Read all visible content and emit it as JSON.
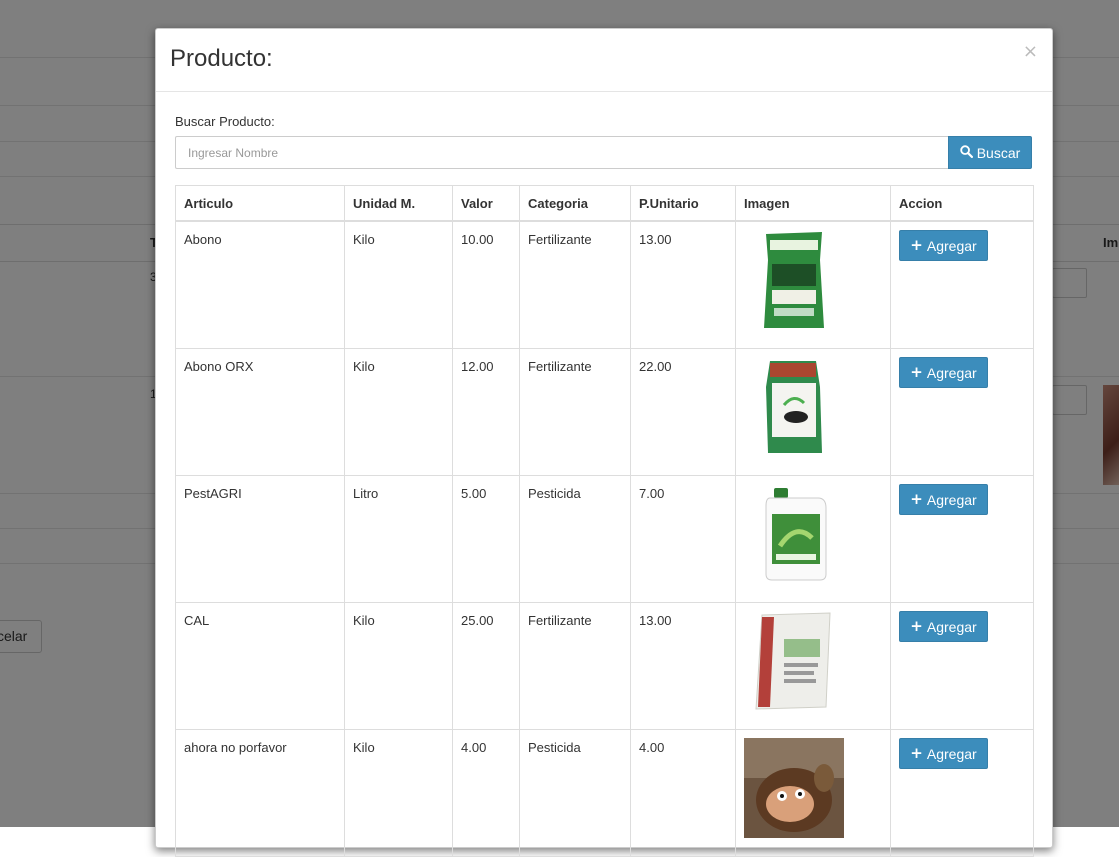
{
  "background": {
    "table_header_fragments": [
      "T",
      "Im"
    ],
    "row_numbers": [
      "3",
      "1"
    ],
    "cancel_fragment": "celar"
  },
  "modal": {
    "title": "Producto:",
    "close_symbol": "×"
  },
  "search": {
    "label": "Buscar Producto:",
    "placeholder": "Ingresar Nombre",
    "value": "",
    "button_label": "Buscar",
    "button_icon": "search-icon"
  },
  "table": {
    "headers": [
      "Articulo",
      "Unidad M.",
      "Valor",
      "Categoria",
      "P.Unitario",
      "Imagen",
      "Accion"
    ],
    "rows": [
      {
        "articulo": "Abono",
        "unidad": "Kilo",
        "valor": "10.00",
        "categoria": "Fertilizante",
        "precio": "13.00",
        "image": "green-fertilizer-bag",
        "action": "Agregar"
      },
      {
        "articulo": "Abono ORX",
        "unidad": "Kilo",
        "valor": "12.00",
        "categoria": "Fertilizante",
        "precio": "22.00",
        "image": "fast-start-bag",
        "action": "Agregar"
      },
      {
        "articulo": "PestAGRI",
        "unidad": "Litro",
        "valor": "5.00",
        "categoria": "Pesticida",
        "precio": "7.00",
        "image": "pesticide-jug",
        "action": "Agregar"
      },
      {
        "articulo": "CAL",
        "unidad": "Kilo",
        "valor": "25.00",
        "categoria": "Fertilizante",
        "precio": "13.00",
        "image": "cal-agricola-sack",
        "action": "Agregar"
      },
      {
        "articulo": "ahora no porfavor",
        "unidad": "Kilo",
        "valor": "4.00",
        "categoria": "Pesticida",
        "precio": "4.00",
        "image": "plush-toy-photo",
        "action": "Agregar"
      }
    ]
  },
  "colors": {
    "primary": "#3c8dbc",
    "overlay": "rgba(0,0,0,0.5)"
  }
}
